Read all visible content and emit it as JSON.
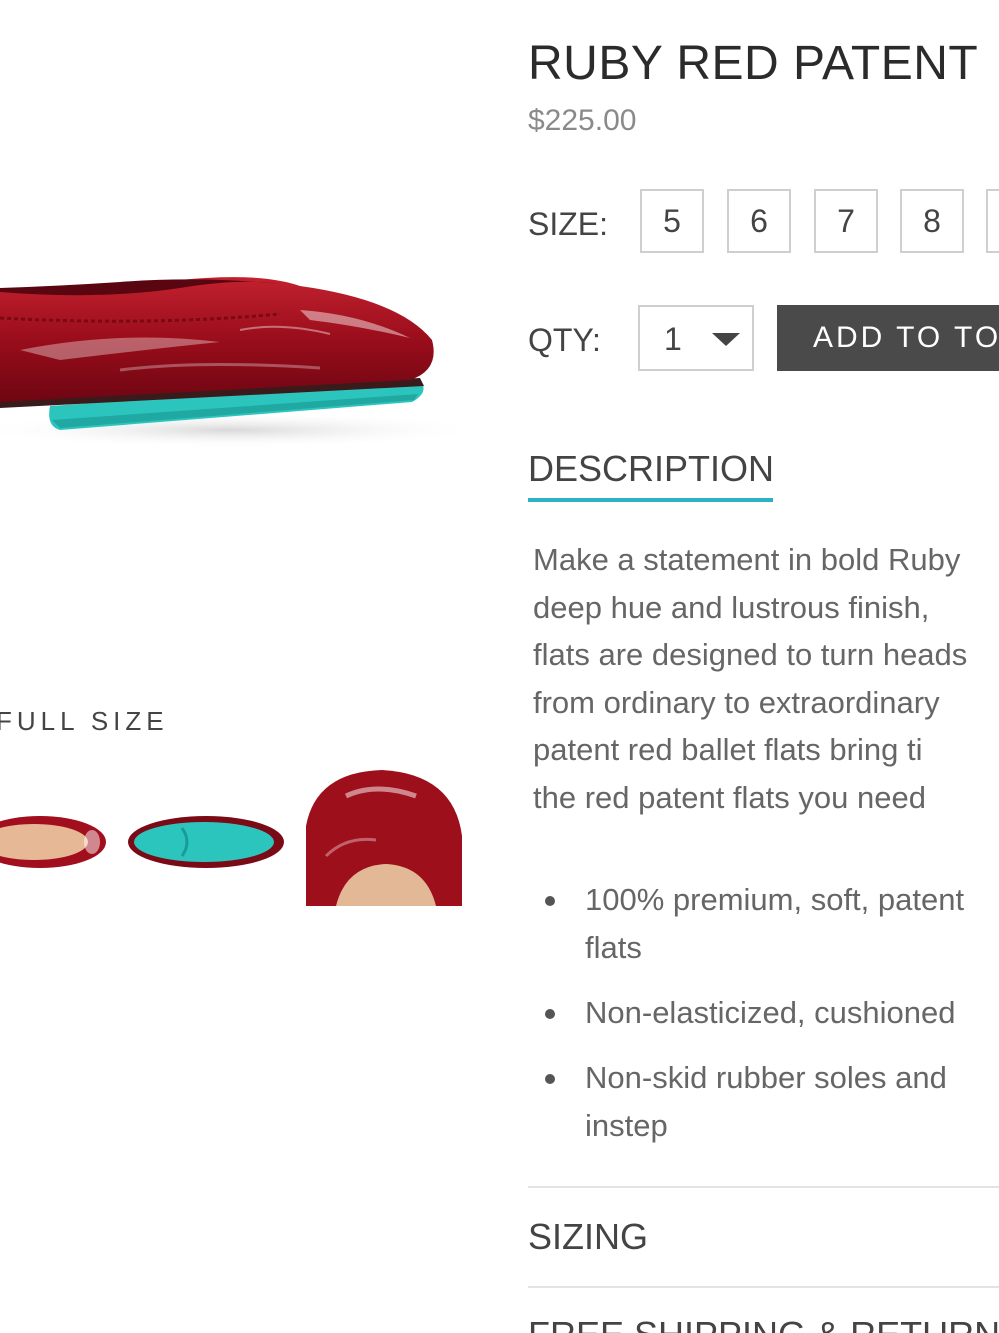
{
  "product": {
    "title": "RUBY RED PATENT",
    "price": "$225.00"
  },
  "gallery": {
    "view_full_size": "FULL SIZE",
    "main_image_icon": "red-patent-ballet-flat-side-view",
    "thumbnails": [
      "pair-top-view",
      "sole-view",
      "toe-closeup"
    ]
  },
  "size": {
    "label": "SIZE:",
    "options": [
      "5",
      "6",
      "7",
      "8",
      ""
    ]
  },
  "quantity": {
    "label": "QTY:",
    "selected": "1"
  },
  "add_button": {
    "label": "ADD TO TOTE"
  },
  "tabs": {
    "description": "DESCRIPTION",
    "sizing": "SIZING",
    "shipping": "FREE SHIPPING & RETURNS"
  },
  "description": {
    "lines": [
      "Make a statement in bold Ruby",
      "deep hue and lustrous finish,",
      "flats are designed to turn heads",
      "from ordinary to extraordinary",
      "patent red ballet flats bring ti",
      "the red patent flats you need"
    ],
    "bullets": [
      [
        "100% premium, soft, patent",
        "flats"
      ],
      [
        "Non-elasticized, cushioned"
      ],
      [
        "Non-skid rubber soles and",
        "instep"
      ]
    ]
  },
  "colors": {
    "accent": "#2bb3c4",
    "button": "#4a4a4a",
    "shoe_red": "#9e0f1c",
    "sole_teal": "#2cc5be"
  }
}
